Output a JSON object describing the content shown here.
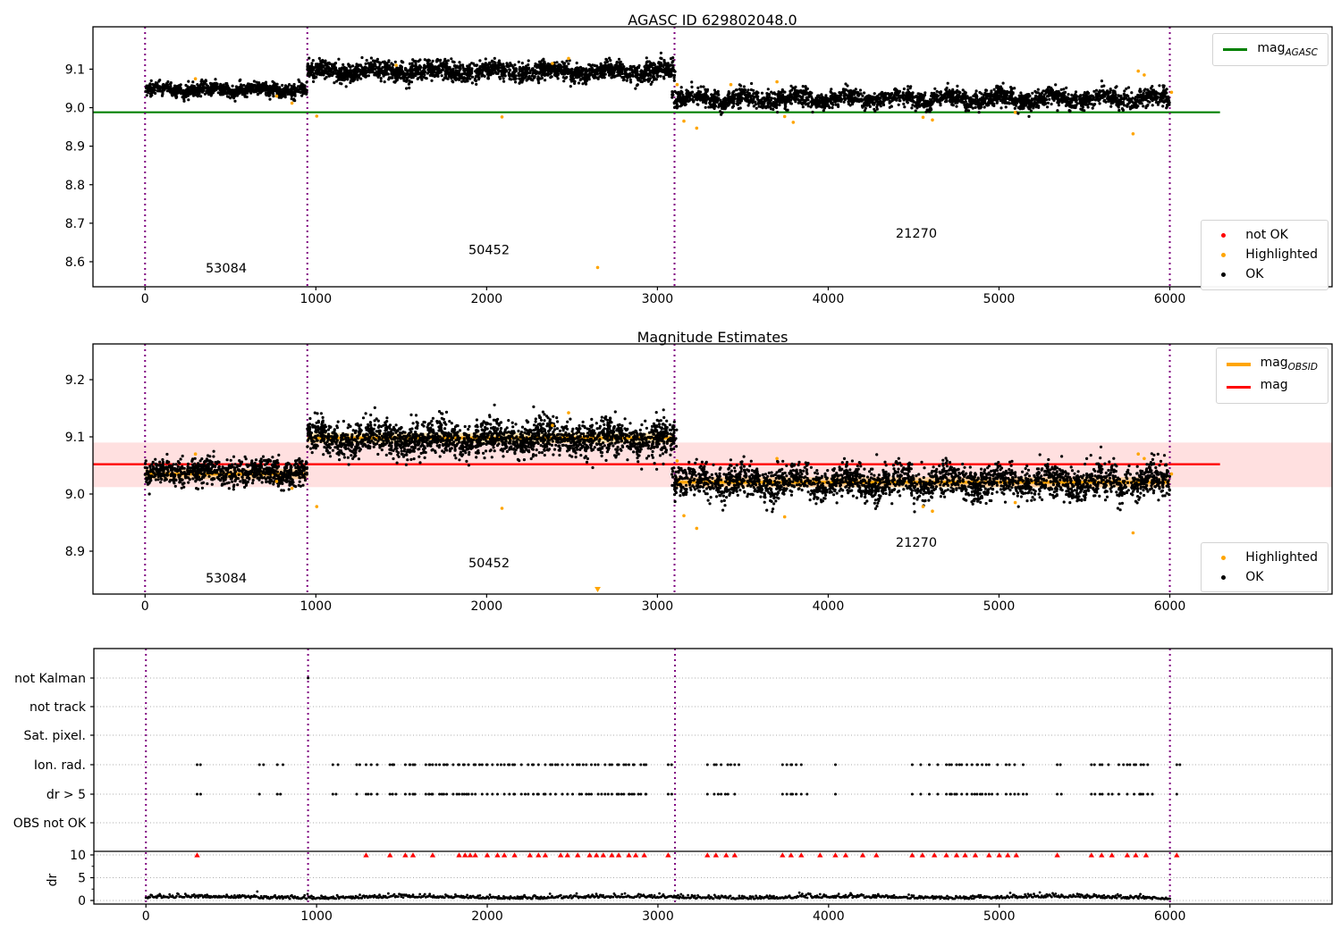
{
  "colors": {
    "green": "#008000",
    "red": "#ff0000",
    "orange": "#ffa500",
    "purple": "#800080",
    "black": "#000000",
    "band_pink": "rgba(255,0,0,0.12)",
    "band_orange": "rgba(255,165,0,0.30)",
    "grid": "#ababab"
  },
  "chart_data": [
    {
      "type": "scatter",
      "title": "AGASC ID 629802048.0",
      "xlim": [
        -305,
        6950
      ],
      "ylim": [
        8.535,
        9.21
      ],
      "x_ticks": [
        "0",
        "1000",
        "2000",
        "3000",
        "4000",
        "5000",
        "6000"
      ],
      "x_tick_values": [
        0,
        1000,
        2000,
        3000,
        4000,
        5000,
        6000
      ],
      "y_ticks": [
        "9.1",
        "9.0",
        "8.9",
        "8.8",
        "8.7",
        "8.6"
      ],
      "y_tick_values": [
        9.1,
        9.0,
        8.9,
        8.8,
        8.7,
        8.6
      ],
      "mag_agasc": 8.988,
      "line_extent": [
        -305,
        6294
      ],
      "legend_line": {
        "main": "mag",
        "sub": "AGASC",
        "color": "#008000"
      },
      "marker_legend": [
        {
          "label": "not OK",
          "color": "#ff0000"
        },
        {
          "label": "Highlighted",
          "color": "#ffa500"
        },
        {
          "label": "OK",
          "color": "#000000"
        }
      ],
      "obsid_boundaries": [
        0,
        950,
        3100,
        6000
      ],
      "annotations": [
        {
          "text": "53084",
          "x": 475,
          "y": 8.572
        },
        {
          "text": "50452",
          "x": 2014,
          "y": 8.62
        },
        {
          "text": "21270",
          "x": 4516,
          "y": 8.663
        }
      ],
      "segments": [
        {
          "x0": 0,
          "x1": 950,
          "n": 850,
          "level": 9.047,
          "sigma": 0.0085,
          "w1": 0.005,
          "p1": 300,
          "w2": 0.003,
          "p2": 70
        },
        {
          "x0": 950,
          "x1": 3100,
          "n": 2100,
          "level": 9.094,
          "sigma": 0.012,
          "w1": 0.007,
          "p1": 340,
          "w2": 0.004,
          "p2": 80
        },
        {
          "x0": 3100,
          "x1": 6000,
          "n": 2500,
          "level": 9.023,
          "sigma": 0.011,
          "w1": 0.009,
          "p1": 300,
          "w2": 0.005,
          "p2": 75
        }
      ],
      "transition": {
        "x0": 3085,
        "x1": 3115,
        "ymin": 8.99,
        "ymax": 9.105,
        "n": 14
      },
      "highlighted": [
        [
          295,
          9.075
        ],
        [
          770,
          9.03
        ],
        [
          860,
          9.012
        ],
        [
          1005,
          8.978
        ],
        [
          1470,
          9.11
        ],
        [
          2090,
          8.976
        ],
        [
          2385,
          9.115
        ],
        [
          2480,
          9.128
        ],
        [
          2650,
          8.585
        ],
        [
          3115,
          9.06
        ],
        [
          3155,
          8.965
        ],
        [
          3230,
          8.947
        ],
        [
          3430,
          9.06
        ],
        [
          3700,
          9.067
        ],
        [
          3745,
          8.977
        ],
        [
          3795,
          8.962
        ],
        [
          4555,
          8.975
        ],
        [
          4610,
          8.968
        ],
        [
          5095,
          8.988
        ],
        [
          5785,
          8.932
        ],
        [
          5815,
          9.095
        ],
        [
          5850,
          9.085
        ],
        [
          6010,
          9.04
        ]
      ]
    },
    {
      "type": "scatter",
      "title": "Magnitude Estimates",
      "xlim": [
        -305,
        6950
      ],
      "ylim": [
        8.825,
        9.2625
      ],
      "x_ticks": [
        "0",
        "1000",
        "2000",
        "3000",
        "4000",
        "5000",
        "6000"
      ],
      "x_tick_values": [
        0,
        1000,
        2000,
        3000,
        4000,
        5000,
        6000
      ],
      "y_ticks": [
        "9.2",
        "9.1",
        "9.0",
        "8.9"
      ],
      "y_tick_values": [
        9.2,
        9.1,
        9.0,
        8.9
      ],
      "mag": 9.052,
      "mag_band": [
        9.012,
        9.09
      ],
      "line_extent": [
        -305,
        6294
      ],
      "obsid_segments": [
        {
          "x0": 0,
          "x1": 950,
          "mag": 9.035
        },
        {
          "x0": 950,
          "x1": 3100,
          "mag": 9.098
        },
        {
          "x0": 3100,
          "x1": 6000,
          "mag": 9.0205
        }
      ],
      "legend_lines": [
        {
          "main": "mag",
          "sub": "OBSID",
          "color": "#ffa500"
        },
        {
          "main": "mag",
          "sub": "",
          "color": "#ff0000"
        }
      ],
      "marker_legend": [
        {
          "label": "Highlighted",
          "color": "#ffa500"
        },
        {
          "label": "OK",
          "color": "#000000"
        }
      ],
      "obsid_boundaries": [
        0,
        950,
        3100,
        6000
      ],
      "annotations": [
        {
          "text": "53084",
          "x": 475,
          "y": 8.845
        },
        {
          "text": "50452",
          "x": 2014,
          "y": 8.872
        },
        {
          "text": "21270",
          "x": 4516,
          "y": 8.908
        }
      ],
      "segments": [
        {
          "x0": 0,
          "x1": 950,
          "n": 850,
          "level": 9.038,
          "sigma": 0.011,
          "w1": 0.005,
          "p1": 300,
          "w2": 0.003,
          "p2": 70
        },
        {
          "x0": 950,
          "x1": 3100,
          "n": 2100,
          "level": 9.097,
          "sigma": 0.015,
          "w1": 0.007,
          "p1": 340,
          "w2": 0.004,
          "p2": 80
        },
        {
          "x0": 3100,
          "x1": 6000,
          "n": 2500,
          "level": 9.021,
          "sigma": 0.014,
          "w1": 0.009,
          "p1": 300,
          "w2": 0.005,
          "p2": 75
        }
      ],
      "transition": {
        "x0": 3085,
        "x1": 3115,
        "ymin": 8.99,
        "ymax": 9.12,
        "n": 14
      },
      "clipped_markers": [
        {
          "x": 2650
        }
      ],
      "highlighted": [
        [
          295,
          9.07
        ],
        [
          770,
          9.022
        ],
        [
          860,
          9.01
        ],
        [
          1005,
          8.978
        ],
        [
          2090,
          8.975
        ],
        [
          2385,
          9.12
        ],
        [
          2480,
          9.142
        ],
        [
          3115,
          9.058
        ],
        [
          3155,
          8.962
        ],
        [
          3230,
          8.94
        ],
        [
          3700,
          9.062
        ],
        [
          3745,
          8.96
        ],
        [
          4555,
          8.978
        ],
        [
          4610,
          8.97
        ],
        [
          5095,
          8.985
        ],
        [
          5785,
          8.932
        ],
        [
          5815,
          9.07
        ],
        [
          5850,
          9.062
        ],
        [
          6010,
          9.035
        ]
      ]
    },
    {
      "type": "flags",
      "flag_labels": [
        "not Kalman",
        "not track",
        "Sat. pixel.",
        "Ion. rad.",
        "dr > 5",
        "OBS not OK"
      ],
      "dr_axis": {
        "label": "dr",
        "ticks": [
          "10",
          "5",
          "0"
        ],
        "tick_values": [
          10,
          5,
          0
        ]
      },
      "x_ticks": [
        "0",
        "1000",
        "2000",
        "3000",
        "4000",
        "5000",
        "6000"
      ],
      "x_tick_values": [
        0,
        1000,
        2000,
        3000,
        4000,
        5000,
        6000
      ],
      "xlim": [
        -305,
        6950
      ],
      "threshold_value": 10,
      "obsid_boundaries": [
        0,
        950,
        3100,
        6000
      ],
      "flags": {
        "not_kalman": [
          950
        ],
        "not_track": [],
        "sat_pixel": [],
        "ion_rad": [
          300,
          665,
          770,
          1095,
          1235,
          1290,
          1320,
          1355,
          1430,
          1445,
          1520,
          1545,
          1565,
          1640,
          1660,
          1680,
          1720,
          1745,
          1762,
          1800,
          1835,
          1865,
          1890,
          1930,
          1970,
          2000,
          2030,
          2060,
          2100,
          2130,
          2160,
          2200,
          2240,
          2270,
          2300,
          2340,
          2370,
          2400,
          2440,
          2470,
          2500,
          2540,
          2580,
          2610,
          2650,
          2690,
          2730,
          2770,
          2800,
          2830,
          2860,
          2900,
          2930,
          3060,
          3290,
          3330,
          3370,
          3410,
          3450,
          3730,
          3755,
          3780,
          3810,
          3840,
          4040,
          4490,
          4540,
          4590,
          4640,
          4690,
          4720,
          4750,
          4780,
          4810,
          4840,
          4870,
          4900,
          4940,
          4990,
          5040,
          5090,
          5140,
          5340,
          5540,
          5590,
          5640,
          5700,
          5750,
          5790,
          5830,
          5870,
          6040
        ],
        "dr_gt_5": [
          300,
          665,
          770,
          1095,
          1235,
          1290,
          1320,
          1355,
          1430,
          1445,
          1520,
          1545,
          1565,
          1640,
          1660,
          1680,
          1720,
          1745,
          1762,
          1800,
          1835,
          1865,
          1890,
          1930,
          1970,
          2000,
          2030,
          2060,
          2100,
          2130,
          2160,
          2200,
          2240,
          2270,
          2300,
          2340,
          2370,
          2400,
          2440,
          2470,
          2500,
          2540,
          2580,
          2610,
          2650,
          2690,
          2730,
          2770,
          2800,
          2830,
          2860,
          2900,
          2930,
          3060,
          3290,
          3330,
          3370,
          3410,
          3450,
          3730,
          3755,
          3780,
          3810,
          3840,
          4040,
          4490,
          4540,
          4590,
          4640,
          4690,
          4720,
          4750,
          4780,
          4810,
          4840,
          4870,
          4900,
          4940,
          4990,
          5040,
          5090,
          5140,
          5340,
          5540,
          5590,
          5640,
          5700,
          5750,
          5790,
          5830,
          5870,
          6040
        ],
        "obs_not_ok": []
      },
      "dr_gt_10_red": [
        300,
        1290,
        1430,
        1520,
        1565,
        1680,
        1835,
        1870,
        1900,
        1930,
        2000,
        2060,
        2100,
        2160,
        2250,
        2300,
        2340,
        2430,
        2470,
        2530,
        2600,
        2640,
        2680,
        2730,
        2770,
        2830,
        2870,
        2920,
        3060,
        3290,
        3340,
        3400,
        3450,
        3730,
        3780,
        3840,
        3950,
        4040,
        4100,
        4200,
        4280,
        4490,
        4550,
        4620,
        4690,
        4750,
        4800,
        4860,
        4940,
        5000,
        5050,
        5100,
        5340,
        5540,
        5600,
        5660,
        5750,
        5800,
        5860,
        6040
      ],
      "dr_trace": {
        "x0": 0,
        "x1": 6000,
        "n": 1040,
        "base": 0.5,
        "amp": 0.35,
        "clamp": [
          0.05,
          2.2
        ]
      }
    }
  ]
}
